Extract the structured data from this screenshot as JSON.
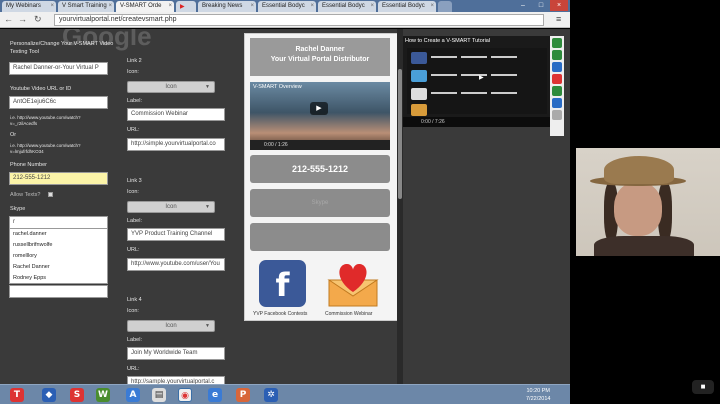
{
  "browser": {
    "tabs": [
      {
        "label": "My Webinars"
      },
      {
        "label": "V Smart Training"
      },
      {
        "label": "V-SMART Orde"
      },
      {
        "label": "YouTube"
      },
      {
        "label": "Breaking News"
      },
      {
        "label": "Essential Bodyc"
      },
      {
        "label": "Essential Bodyc"
      },
      {
        "label": "Essential Bodyc"
      }
    ],
    "url": "yourvirtualportal.net/createvsmart.php",
    "watermark": "Google"
  },
  "form": {
    "heading_line1": "Personalize/Change Your V-SMART Video",
    "heading_line2": "Texting Tool",
    "name_value": "Rachel Danner-or-Your Virtual P",
    "youtube_label": "Youtube Video URL or ID",
    "youtube_value": "AntOE1eju6C6c",
    "example1_line1": "i.e. http://www.youtube.com/watch?",
    "example1_line2": "v=_r2ilAcedfs",
    "or_label": "Or",
    "example2_line1": "i.e. http://www.youtube.com/watch?",
    "example2_line2": "v=lmjufrfdhKO34",
    "phone_label": "Phone Number",
    "phone_value": "212-555-1212",
    "allow_texts_label": "Allow Texts?",
    "skype_label": "Skype",
    "skype_value": "r",
    "autocomplete": [
      "rachel.danner",
      "russellbrifnwolfe",
      "romelllory",
      "Rachel Danner",
      "Rodney Epps"
    ]
  },
  "links": {
    "link2_title": "Link 2",
    "link3_title": "Link 3",
    "link4_title": "Link 4",
    "icon_label": "Icon:",
    "label_label": "Label:",
    "url_label": "URL:",
    "icon_select": "Icon",
    "link2_label_value": "Commission Webinar",
    "link2_url_value": "http://simple.yourvirtualportal.co",
    "link3_label_value": "YVP Product Training Channel",
    "link3_url_value": "http://www.youtube.com/user/You",
    "link4_label_value": "Join My Worldwide Team",
    "link4_url_value": "http://sample.yourvirtualportal.c"
  },
  "preview": {
    "header_line1": "Rachel Danner",
    "header_line2": "Your Virtual Portal Distributor",
    "video_title": "V-SMART Overview",
    "video_time": "0:00 / 1:26",
    "phone_button": "212-555-1212",
    "skype_button": "Skype",
    "blank_button": "",
    "tile1_caption": "YVP Facebook Contests",
    "tile2_caption": "Commission Webinar"
  },
  "right_video": {
    "title": "How to Create a V-SMART Tutorial",
    "time": "0:00 / 7:26"
  },
  "taskbar": {
    "time": "10:20 PM",
    "date": "7/22/2014"
  },
  "colors": {
    "page_bg": "#3a3a3a",
    "phone_field_bg": "#fbf4a8",
    "facebook_blue": "#3b5998",
    "taskbar": "#6c87a8"
  }
}
